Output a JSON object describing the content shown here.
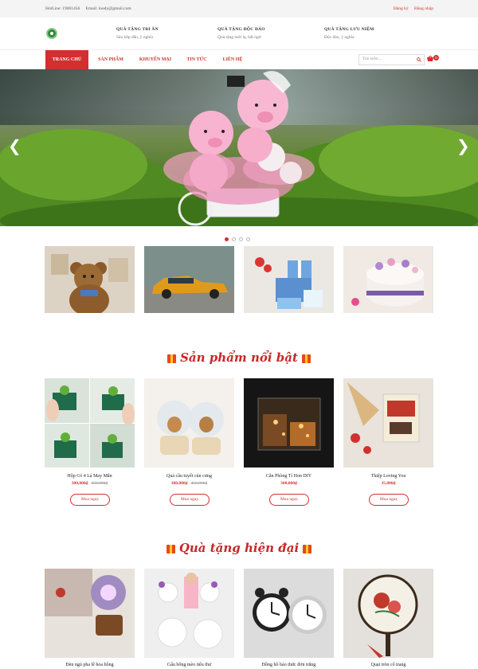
{
  "topbar": {
    "hotline": "HotLine: 19001456",
    "email": "Email: loody@gmail.com",
    "register": "Đăng ký",
    "login": "Đăng nhập"
  },
  "header": {
    "features": [
      {
        "title": "QUÀ TẶNG TRI ÂN",
        "sub": "Sâu bắp dẫn, ý nghĩa"
      },
      {
        "title": "QUÀ TẶNG ĐỘC ĐÁO",
        "sub": "Quà tặng mới lạ, bất ngờ"
      },
      {
        "title": "QUÀ TẶNG LƯU NIỆM",
        "sub": "Độc đáo, ý nghĩa"
      }
    ]
  },
  "nav": {
    "items": [
      "TRANG CHỦ",
      "SẢN PHẨM",
      "KHUYẾN MẠI",
      "TIN TỨC",
      "LIÊN HỆ"
    ],
    "search_placeholder": "Tìm kiếm ...",
    "cart_count": "0"
  },
  "hero": {
    "prev": "❮",
    "next": "❯",
    "active_dot": 0,
    "dot_count": 4
  },
  "featured": {
    "title": "Sản phẩm nổi bật",
    "products": [
      {
        "name": "Hộp Cỏ 4 Lá May Mắn",
        "price": "300,000₫",
        "old": "450,000₫",
        "buy": "Mua ngay"
      },
      {
        "name": "Quả cầu tuyết cún cưng",
        "price": "300,000₫",
        "old": "450,000₫",
        "buy": "Mua ngay"
      },
      {
        "name": "Căn Phòng Tí Hon DIY",
        "price": "300,000₫",
        "old": "",
        "buy": "Mua ngay"
      },
      {
        "name": "Thiệp Loving You",
        "price": "35,000₫",
        "old": "",
        "buy": "Mua ngay"
      }
    ]
  },
  "modern": {
    "title": "Quà tặng hiện đại",
    "products": [
      {
        "name": "Đèn ngủ pha lê hoa hồng"
      },
      {
        "name": "Gấu bông mèo tiểu thư"
      },
      {
        "name": "Đồng hồ báo thức đơn trắng"
      },
      {
        "name": "Quạt tròn cổ trang"
      }
    ]
  },
  "colors": {
    "accent": "#d32f2f"
  }
}
